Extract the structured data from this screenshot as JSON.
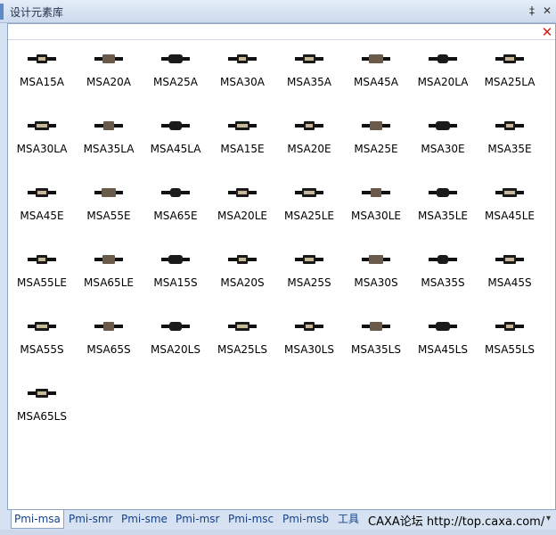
{
  "window": {
    "title": "设计元素库",
    "pin_glyph": "‡",
    "close_glyph": "✕",
    "panel_close_glyph": "✕"
  },
  "items": [
    "MSA15A",
    "MSA20A",
    "MSA25A",
    "MSA30A",
    "MSA35A",
    "MSA45A",
    "MSA20LA",
    "MSA25LA",
    "MSA30LA",
    "MSA35LA",
    "MSA45LA",
    "MSA15E",
    "MSA20E",
    "MSA25E",
    "MSA30E",
    "MSA35E",
    "MSA45E",
    "MSA55E",
    "MSA65E",
    "MSA20LE",
    "MSA25LE",
    "MSA30LE",
    "MSA35LE",
    "MSA45LE",
    "MSA55LE",
    "MSA65LE",
    "MSA15S",
    "MSA20S",
    "MSA25S",
    "MSA30S",
    "MSA35S",
    "MSA45S",
    "MSA55S",
    "MSA65S",
    "MSA20LS",
    "MSA25LS",
    "MSA30LS",
    "MSA35LS",
    "MSA45LS",
    "MSA55LS",
    "MSA65LS"
  ],
  "tabs": [
    "Pmi-msa",
    "Pmi-smr",
    "Pmi-sme",
    "Pmi-msr",
    "Pmi-msc",
    "Pmi-msb",
    "工具"
  ],
  "watermark": "CAXA论坛 http://top.caxa.com/",
  "tab_overflow_glyph": "▾",
  "colors": {
    "accent": "#d21c1c",
    "tab_text": "#15428b"
  }
}
